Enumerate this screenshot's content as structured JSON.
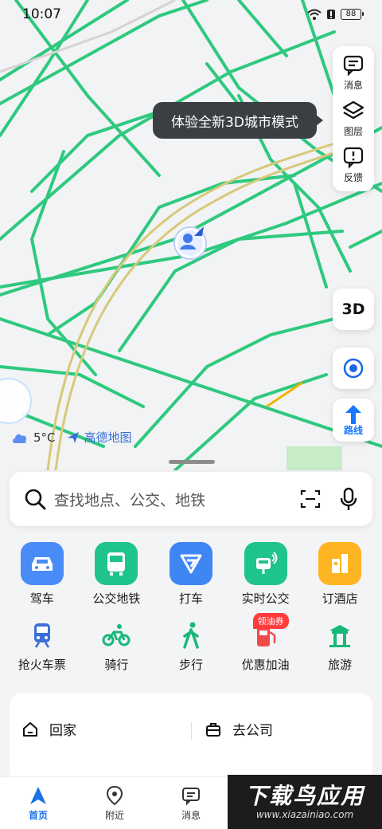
{
  "status_bar": {
    "time": "10:07",
    "battery": "88"
  },
  "map": {
    "tooltip": "体验全新3D城市模式",
    "side_buttons": [
      {
        "label": "消息",
        "icon": "message-icon"
      },
      {
        "label": "图层",
        "icon": "layers-icon"
      },
      {
        "label": "反馈",
        "icon": "feedback-icon"
      }
    ],
    "btn_3d": "3D",
    "route_label": "路线",
    "weather": {
      "temp": "5°C",
      "brand": "高德地图"
    }
  },
  "search": {
    "placeholder": "查找地点、公交、地铁"
  },
  "quick_row1": [
    {
      "label": "驾车",
      "icon": "car-icon",
      "color": "#4a8cf7"
    },
    {
      "label": "公交地铁",
      "icon": "bus-icon",
      "color": "#1ec48c"
    },
    {
      "label": "打车",
      "icon": "taxi-icon",
      "color": "#3f86f5"
    },
    {
      "label": "实时公交",
      "icon": "realtime-bus-icon",
      "color": "#1ec48c"
    },
    {
      "label": "订酒店",
      "icon": "hotel-icon",
      "color": "#ffb421"
    }
  ],
  "quick_row2": [
    {
      "label": "抢火车票",
      "icon": "train-icon"
    },
    {
      "label": "骑行",
      "icon": "bike-icon"
    },
    {
      "label": "步行",
      "icon": "walk-icon"
    },
    {
      "label": "优惠加油",
      "icon": "fuel-icon",
      "badge": "领油券"
    },
    {
      "label": "旅游",
      "icon": "travel-icon"
    }
  ],
  "shortcuts": {
    "home": "回家",
    "work": "去公司"
  },
  "bottom_nav": [
    {
      "label": "首页",
      "icon": "navigation-arrow-icon"
    },
    {
      "label": "附近",
      "icon": "location-pin-icon"
    },
    {
      "label": "消息",
      "icon": "message-icon"
    }
  ],
  "watermark": {
    "main": "下载鸟应用",
    "sub": "www.xiazainiao.com"
  }
}
